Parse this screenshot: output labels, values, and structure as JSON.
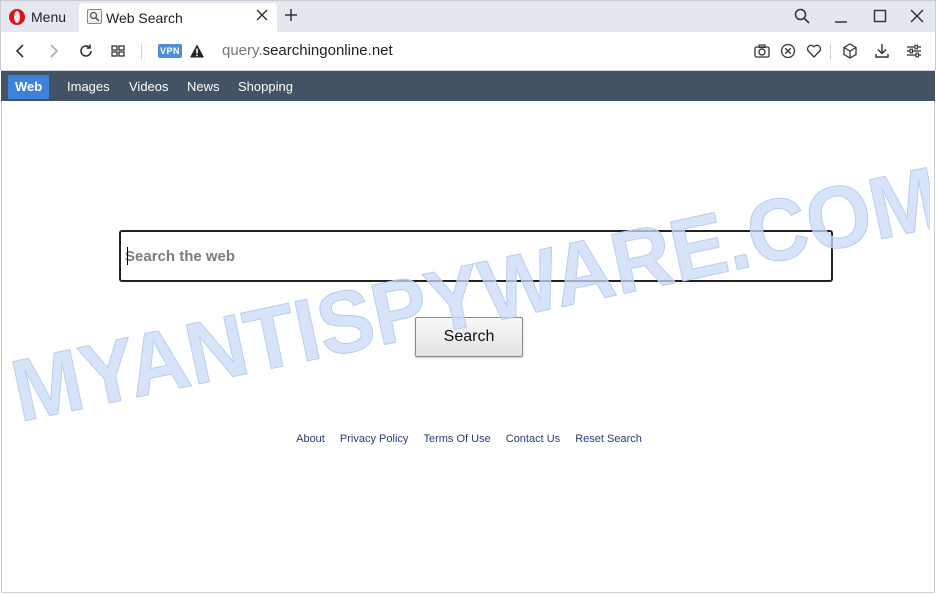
{
  "browser": {
    "menu_label": "Menu",
    "tab_title": "Web Search",
    "url_subdomain": "query.",
    "url_domain": "searchingonline.net",
    "vpn_label": "VPN"
  },
  "site_nav": {
    "items": [
      "Web",
      "Images",
      "Videos",
      "News",
      "Shopping"
    ],
    "active": "Web"
  },
  "search": {
    "placeholder": "Search the web",
    "button_label": "Search"
  },
  "footer": {
    "links": [
      "About",
      "Privacy Policy",
      "Terms Of Use",
      "Contact Us",
      "Reset Search"
    ]
  },
  "watermark": "MYANTISPYWARE.COM",
  "colors": {
    "site_nav_bg": "#435264",
    "active_tab_bg": "#3c82d6",
    "vpn_badge": "#4d8fd6",
    "opera_red": "#e0111b",
    "watermark": "#c8daf5"
  },
  "icons": [
    "opera-logo-icon",
    "search-favicon-icon",
    "close-icon",
    "plus-icon",
    "search-icon",
    "minimize-icon",
    "maximize-icon",
    "close-window-icon",
    "back-icon",
    "forward-icon",
    "reload-icon",
    "speed-dial-icon",
    "warning-icon",
    "snapshot-icon",
    "adblock-icon",
    "heart-icon",
    "cube-icon",
    "download-icon",
    "settings-sliders-icon"
  ]
}
